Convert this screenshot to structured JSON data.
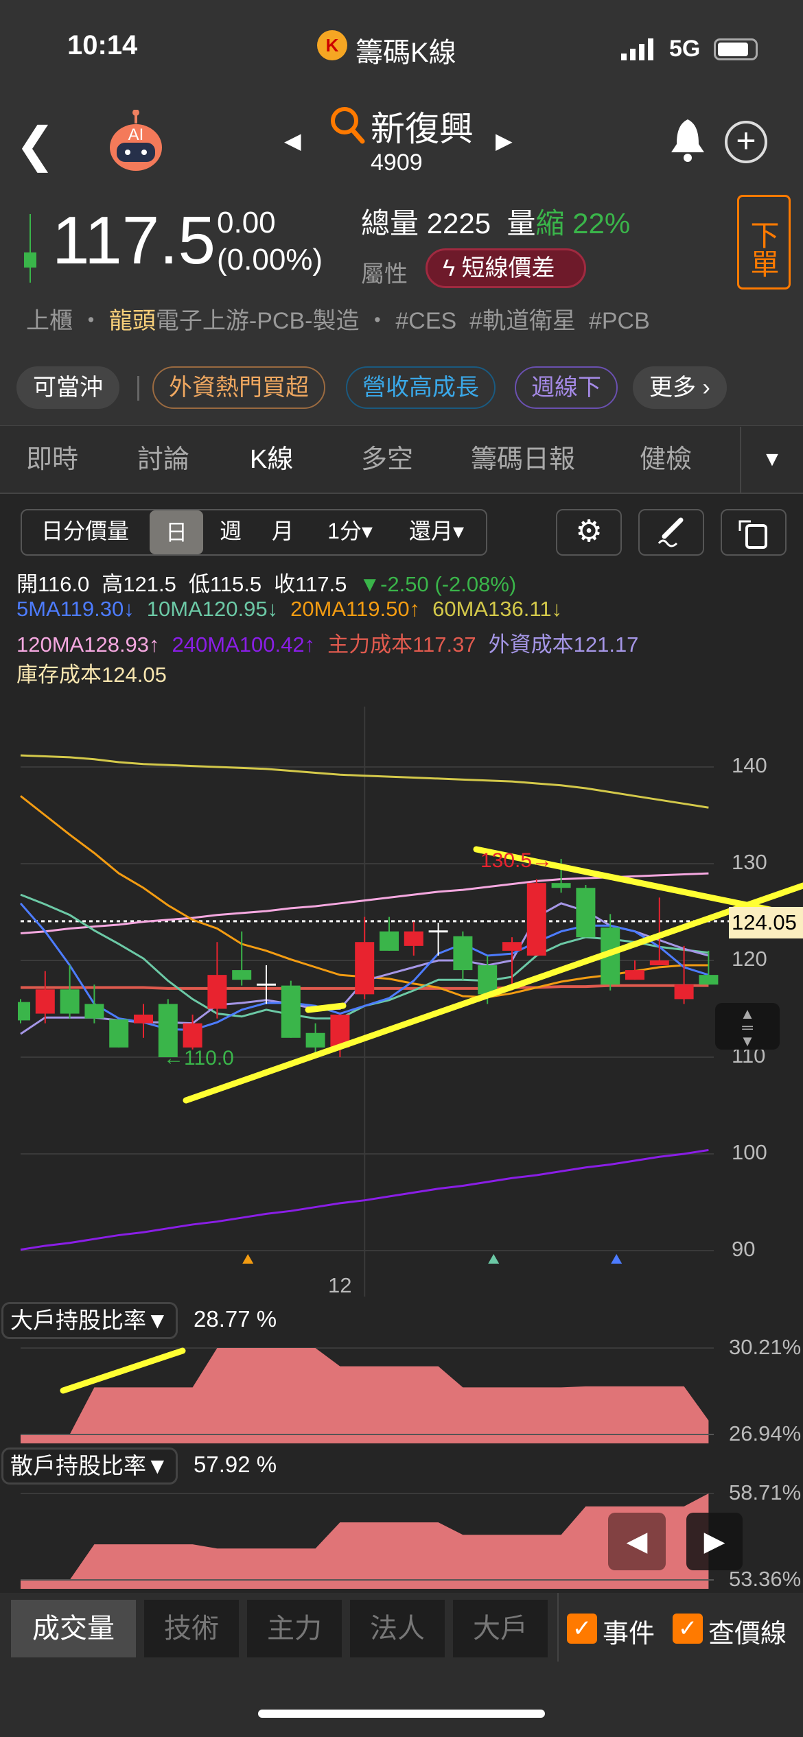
{
  "status": {
    "time": "10:14",
    "app_title": "籌碼K線",
    "network": "5G"
  },
  "stock": {
    "name": "新復興",
    "code": "4909",
    "price": "117.5",
    "change": "0.00",
    "change_pct": "(0.00%)",
    "volume_label": "總量",
    "volume": "2225",
    "vol_change_prefix": "量",
    "vol_change_word": "縮",
    "vol_change_pct": "22%",
    "attr_label": "屬性",
    "attr_badge": "短線價差",
    "order_btn": "下單"
  },
  "tags": {
    "market": "上櫃",
    "sep": "・",
    "leader": "龍頭",
    "industry": "電子上游-PCB-製造",
    "sep2": "・",
    "t1": "#CES",
    "t2": "#軌道衛星",
    "t3": "#PCB"
  },
  "chips": [
    "可當沖",
    "外資熱門買超",
    "營收高成長",
    "週線下",
    "更多 ›"
  ],
  "tabs": [
    "即時",
    "討論",
    "K線",
    "多空",
    "籌碼日報",
    "健檢"
  ],
  "toolbar": {
    "segments": [
      "日分價量",
      "日",
      "週",
      "月",
      "1分▾",
      "還月▾"
    ]
  },
  "ohlc": {
    "open": "開116.0",
    "high": "高121.5",
    "low": "低115.5",
    "close": "收117.5",
    "change": "▼-2.50 (-2.08%)"
  },
  "legend": [
    {
      "text": "5MA119.30↓",
      "color": "#4d7cff"
    },
    {
      "text": "10MA120.95↓",
      "color": "#6cc9a6"
    },
    {
      "text": "20MA119.50↑",
      "color": "#f39c12"
    },
    {
      "text": "60MA136.11↓",
      "color": "#d4c94a"
    },
    {
      "text": "120MA128.93↑",
      "color": "#f5a8e0"
    },
    {
      "text": "240MA100.42↑",
      "color": "#8a1ee6"
    },
    {
      "text": "主力成本117.37",
      "color": "#e05a4e"
    },
    {
      "text": "外資成本121.17",
      "color": "#a596e6"
    },
    {
      "text": "庫存成本124.05",
      "color": "#f8e6b0"
    }
  ],
  "chart_data": {
    "type": "candlestick",
    "y_ticks": [
      "140",
      "130",
      "120",
      "110",
      "100",
      "90"
    ],
    "ylim": [
      88,
      145
    ],
    "x_tick_label": "12",
    "x_tick_index": 14,
    "high_label": "130.5→",
    "low_label": "←110.0",
    "cost_label": "124.05",
    "cost_value": 124.05,
    "candles": [
      [
        115.7,
        116,
        113.5,
        113.8
      ],
      [
        114.5,
        118.9,
        113.5,
        117
      ],
      [
        117,
        119.5,
        114,
        114.5
      ],
      [
        115.5,
        117.5,
        113.5,
        114
      ],
      [
        113.9,
        113.9,
        111,
        111
      ],
      [
        113.5,
        115.5,
        112,
        114.4
      ],
      [
        115.5,
        116,
        110,
        110
      ],
      [
        111,
        114.4,
        110.8,
        113.5
      ],
      [
        115,
        121.9,
        114,
        118.5
      ],
      [
        119,
        123,
        117.4,
        118
      ],
      [
        117.5,
        119.5,
        115.5,
        117.5
      ],
      [
        117.4,
        117.9,
        112,
        112
      ],
      [
        112.5,
        113.5,
        110.5,
        111
      ],
      [
        111,
        114.4,
        110,
        114.4
      ],
      [
        116.5,
        124.5,
        116,
        121.9
      ],
      [
        123,
        124.5,
        121,
        121
      ],
      [
        121.5,
        124,
        120.5,
        123
      ],
      [
        123,
        123.9,
        120.5,
        123
      ],
      [
        122.5,
        123,
        118,
        119
      ],
      [
        119.5,
        120.5,
        115.5,
        116.5
      ],
      [
        121,
        122.4,
        116.9,
        121.9
      ],
      [
        120.5,
        128.4,
        120.5,
        128
      ],
      [
        128,
        130.5,
        127,
        127.5
      ],
      [
        127.5,
        127.8,
        122.4,
        122.4
      ],
      [
        123.4,
        124.8,
        116.9,
        117.5
      ],
      [
        118,
        120,
        118,
        119
      ],
      [
        119.5,
        126.5,
        119.5,
        120
      ],
      [
        116,
        121.5,
        115.5,
        117.5
      ],
      [
        118.5,
        121,
        117.5,
        117.5
      ]
    ],
    "series": [
      {
        "key": "5MA",
        "color": "#4d7cff",
        "values": [
          125.9,
          123,
          119.5,
          115.5,
          114,
          113.6,
          112.9,
          112.8,
          113.6,
          114.9,
          115.6,
          115.6,
          115.3,
          114.5,
          115.3,
          116.1,
          117.9,
          120.7,
          121.7,
          120.5,
          120.7,
          121.9,
          123,
          123.6,
          123.6,
          123,
          121.4,
          119.3,
          118.5
        ]
      },
      {
        "key": "10MA",
        "color": "#6cc9a6",
        "values": [
          126.8,
          125.8,
          124.7,
          123.1,
          121.7,
          120.2,
          117.9,
          116,
          114.5,
          114.2,
          114.9,
          114.4,
          114,
          114,
          115.3,
          115.9,
          116.9,
          118,
          118,
          117.9,
          118.3,
          120.5,
          121.7,
          122.4,
          122.2,
          121.9,
          121.4,
          121.1,
          120.8
        ]
      },
      {
        "key": "20MA",
        "color": "#f39c12",
        "values": [
          137,
          135,
          133,
          131.1,
          129,
          127.5,
          125.7,
          124.2,
          123.3,
          121.7,
          121,
          120.1,
          119.3,
          118.5,
          118.3,
          118.1,
          117.6,
          117.2,
          116.3,
          116.2,
          116.6,
          117.2,
          117.8,
          118.2,
          118.5,
          118.9,
          119.3,
          119.5,
          119.5
        ]
      },
      {
        "key": "60MA",
        "color": "#d4c94a",
        "values": [
          141.2,
          141.1,
          141,
          140.8,
          140.5,
          140.3,
          140.2,
          140.1,
          140,
          139.9,
          139.8,
          139.6,
          139.4,
          139.2,
          139.1,
          139,
          138.9,
          138.8,
          138.7,
          138.6,
          138.5,
          138.3,
          138.1,
          137.8,
          137.4,
          137,
          136.6,
          136.2,
          135.8
        ]
      },
      {
        "key": "120MA",
        "color": "#f5a8e0",
        "values": [
          122.8,
          123,
          123.3,
          123.5,
          123.7,
          124,
          124.2,
          124.4,
          124.7,
          124.9,
          125.1,
          125.4,
          125.6,
          125.9,
          126.2,
          126.5,
          126.8,
          127.1,
          127.3,
          127.6,
          127.9,
          128.2,
          128.4,
          128.5,
          128.6,
          128.7,
          128.8,
          128.9,
          129
        ]
      },
      {
        "key": "240MA",
        "color": "#8a1ee6",
        "values": [
          90.1,
          90.5,
          90.8,
          91.2,
          91.6,
          91.9,
          92.3,
          92.7,
          93,
          93.4,
          93.8,
          94.1,
          94.5,
          94.9,
          95.2,
          95.6,
          96,
          96.4,
          96.7,
          97.1,
          97.5,
          97.8,
          98.2,
          98.6,
          98.9,
          99.3,
          99.7,
          100,
          100.4
        ]
      },
      {
        "key": "主力成本",
        "color": "#e05a4e",
        "values": [
          117.2,
          117.2,
          117.2,
          117.2,
          117.2,
          117.2,
          117.1,
          117.1,
          117.1,
          117.1,
          117.1,
          117.1,
          117.1,
          117.1,
          117.1,
          117.1,
          117.1,
          117.1,
          117.1,
          117.1,
          117.2,
          117.2,
          117.3,
          117.3,
          117.4,
          117.4,
          117.4,
          117.4,
          117.4
        ]
      },
      {
        "key": "外資成本",
        "color": "#a596e6",
        "values": [
          112.4,
          114.1,
          114.1,
          114.1,
          113.8,
          113.6,
          113.6,
          113.5,
          115.4,
          115.6,
          115.9,
          115.5,
          115,
          115,
          117.9,
          118.6,
          119.3,
          120,
          120,
          119.5,
          120,
          124.5,
          125.9,
          125.1,
          123.6,
          123,
          122.1,
          121.2,
          120.5
        ]
      }
    ],
    "event_marks": [
      {
        "index": 9,
        "color": "#f39c12"
      },
      {
        "index": 19,
        "color": "#6cc9a6"
      },
      {
        "index": 24,
        "color": "#4d7cff"
      }
    ],
    "panels": [
      {
        "label": "大戶持股比率▼",
        "value": "28.77 %",
        "max_label": "30.21%",
        "min_label": "26.94%",
        "range": [
          26.94,
          30.21
        ],
        "values": [
          26.94,
          26.94,
          26.94,
          28.72,
          28.72,
          28.72,
          28.72,
          28.72,
          30.21,
          30.21,
          30.21,
          30.21,
          30.21,
          29.52,
          29.52,
          29.52,
          29.52,
          29.52,
          28.72,
          28.72,
          28.72,
          28.72,
          28.72,
          28.76,
          28.76,
          28.76,
          28.76,
          28.76,
          27.47
        ]
      },
      {
        "label": "散戶持股比率▼",
        "value": "57.92 %",
        "max_label": "58.71%",
        "min_label": "53.36%",
        "range": [
          53.36,
          58.71
        ],
        "values": [
          53.36,
          53.36,
          53.36,
          55.56,
          55.56,
          55.56,
          55.56,
          55.56,
          55.3,
          55.3,
          55.3,
          55.3,
          55.3,
          56.92,
          56.92,
          56.92,
          56.92,
          56.92,
          56.15,
          56.15,
          56.15,
          56.15,
          56.15,
          57.91,
          57.91,
          57.91,
          57.91,
          57.91,
          58.71
        ]
      }
    ]
  },
  "bottom_tabs": [
    "成交量",
    "技術",
    "主力",
    "法人",
    "大戶"
  ],
  "checks": [
    "事件",
    "查價線"
  ]
}
